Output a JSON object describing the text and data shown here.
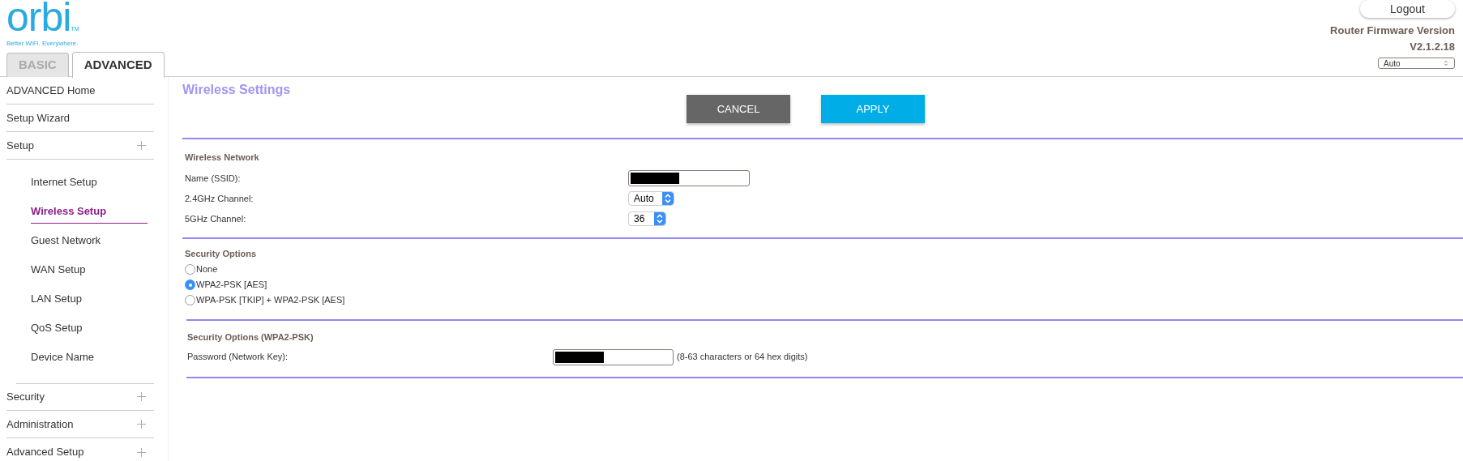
{
  "logo": {
    "wordmark": "orbi",
    "trademark": "TM",
    "tagline": "Better WiFi. Everywhere."
  },
  "tabs": [
    {
      "label": "BASIC",
      "selected": false
    },
    {
      "label": "ADVANCED",
      "selected": true
    }
  ],
  "header": {
    "logout": "Logout",
    "firmware_label": "Router Firmware Version",
    "firmware_version": "V2.1.2.18",
    "language": "Auto"
  },
  "sidebar": {
    "items": [
      {
        "label": "ADVANCED Home",
        "expandable": false,
        "selected": false
      },
      {
        "label": "Setup Wizard",
        "expandable": false,
        "selected": false
      },
      {
        "label": "Setup",
        "expandable": true,
        "selected": false,
        "children": [
          {
            "label": "Internet Setup",
            "selected": false
          },
          {
            "label": "Wireless Setup",
            "selected": true
          },
          {
            "label": "Guest Network",
            "selected": false
          },
          {
            "label": "WAN Setup",
            "selected": false
          },
          {
            "label": "LAN Setup",
            "selected": false
          },
          {
            "label": "QoS Setup",
            "selected": false
          },
          {
            "label": "Device Name",
            "selected": false
          }
        ]
      },
      {
        "label": "Security",
        "expandable": true,
        "selected": false
      },
      {
        "label": "Administration",
        "expandable": true,
        "selected": false
      },
      {
        "label": "Advanced Setup",
        "expandable": true,
        "selected": false
      }
    ]
  },
  "page": {
    "title": "Wireless Settings",
    "buttons": [
      {
        "label": "CANCEL",
        "kind": "secondary"
      },
      {
        "label": "APPLY",
        "kind": "primary"
      }
    ],
    "wireless_network": {
      "heading": "Wireless Network",
      "fields": [
        {
          "label": "Name (SSID):",
          "kind": "text",
          "redacted": true
        },
        {
          "label": "2.4GHz Channel:",
          "kind": "select",
          "value": "Auto"
        },
        {
          "label": "5GHz Channel:",
          "kind": "select",
          "value": "36"
        }
      ]
    },
    "security_options": {
      "heading": "Security Options",
      "options": [
        {
          "label": "None",
          "selected": false
        },
        {
          "label": "WPA2-PSK [AES]",
          "selected": true
        },
        {
          "label": "WPA-PSK [TKIP] + WPA2-PSK [AES]",
          "selected": false
        }
      ]
    },
    "wpa2": {
      "heading": "Security Options (WPA2-PSK)",
      "label": "Password (Network Key):",
      "redacted": true,
      "hint": "(8-63 characters or 64 hex digits)"
    }
  }
}
